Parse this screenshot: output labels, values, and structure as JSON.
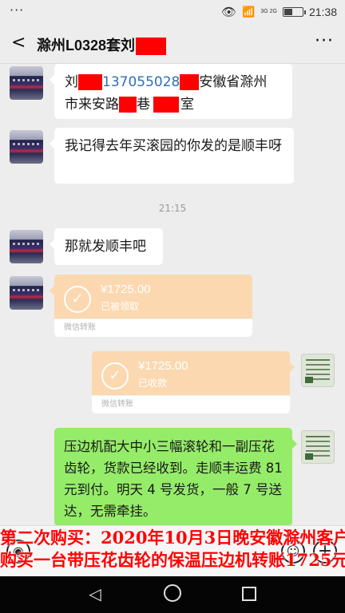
{
  "status_bar": {
    "dots": "···",
    "network": "3G 2G",
    "time": "21:38",
    "battery_level": 0.4
  },
  "header": {
    "title_prefix": "滁州L0328套刘",
    "back_label": "<",
    "more_label": "···"
  },
  "messages": [
    {
      "side": "left",
      "type": "text",
      "parts": {
        "name": "刘",
        "phone": "137055028",
        "province": "安徽省滁州",
        "line2_start": "市来安路",
        "line2_mid": "巷",
        "line2_end": "室"
      }
    },
    {
      "side": "left",
      "type": "text",
      "text": "我记得去年买滚园的你发的是顺丰呀"
    },
    {
      "side": "center",
      "type": "time",
      "text": "21:15"
    },
    {
      "side": "left",
      "type": "text",
      "text": "那就发顺丰吧"
    },
    {
      "side": "left",
      "type": "transfer",
      "amount": "¥1725.00",
      "status": "已被领取",
      "footer": "微信转账"
    },
    {
      "side": "right",
      "type": "transfer",
      "amount": "¥1725.00",
      "status": "已收款",
      "footer": "微信转账"
    },
    {
      "side": "right",
      "type": "text",
      "text": "压边机配大中小三幅滚轮和一副压花齿轮，货款已经收到。走顺丰运费 81 元到付。明天 4 号发货，一般 7 号送达，无需牵挂。"
    }
  ],
  "caption": {
    "line1": "第二次购买：2020年10月3日晚安徽滁州客户",
    "line2": "购买一台带压花齿轮的保温压边机转账1725元"
  },
  "input_bar": {
    "voice_icon": "◉",
    "emoji_icon": "☺",
    "plus_icon": "+"
  },
  "nav": {
    "back_icon": "◁",
    "home_icon": "○",
    "recent_icon": "□"
  },
  "colors": {
    "redaction": "#ff0000",
    "sent_bubble": "#95ec69",
    "transfer": "#fbd8b0",
    "caption": "#ff0000"
  }
}
